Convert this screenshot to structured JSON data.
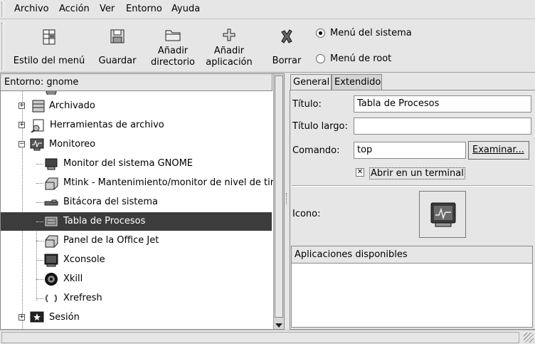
{
  "menubar": {
    "items": [
      "Archivo",
      "Acción",
      "Ver",
      "Entorno",
      "Ayuda"
    ]
  },
  "toolbar": {
    "buttons": [
      {
        "label": "Estilo del menú",
        "icon": "menu-style-icon"
      },
      {
        "label": "Guardar",
        "icon": "floppy-disk-icon"
      },
      {
        "label": "Añadir\ndirectorio",
        "line1": "Añadir",
        "line2": "directorio",
        "icon": "folder-icon"
      },
      {
        "label": "Añadir\naplicación",
        "line1": "Añadir",
        "line2": "aplicación",
        "icon": "add-icon"
      },
      {
        "label": "Borrar",
        "icon": "delete-icon"
      }
    ],
    "radios": [
      {
        "label": "Menú del sistema",
        "selected": true
      },
      {
        "label": "Menú de root",
        "selected": false
      }
    ]
  },
  "tree": {
    "header": "Entorno: gnome",
    "items": [
      {
        "label": "Archivado",
        "level": 0,
        "expander": "+",
        "icon": "archive-icon"
      },
      {
        "label": "Herramientas de archivo",
        "level": 0,
        "expander": "+",
        "icon": "file-tools-icon"
      },
      {
        "label": "Monitoreo",
        "level": 0,
        "expander": "-",
        "icon": "monitor-icon"
      },
      {
        "label": "Monitor del sistema GNOME",
        "level": 1,
        "icon": "system-monitor-icon"
      },
      {
        "label": "Mtink - Mantenimiento/monitor de nivel de tir",
        "level": 1,
        "icon": "printer-icon"
      },
      {
        "label": "Bitácora del sistema",
        "level": 1,
        "icon": "log-icon"
      },
      {
        "label": "Tabla de Procesos",
        "level": 1,
        "icon": "process-table-icon",
        "selected": true
      },
      {
        "label": "Panel de la Office Jet",
        "level": 1,
        "icon": "printer-icon"
      },
      {
        "label": "Xconsole",
        "level": 1,
        "icon": "console-icon"
      },
      {
        "label": "Xkill",
        "level": 1,
        "icon": "xkill-icon"
      },
      {
        "label": "Xrefresh",
        "level": 1,
        "icon": "refresh-icon"
      },
      {
        "label": "Sesión",
        "level": 0,
        "expander": "+",
        "icon": "session-icon"
      }
    ]
  },
  "editor": {
    "tabs": [
      "General",
      "Extendido"
    ],
    "active_tab": "General",
    "titulo_label": "Título:",
    "titulo_value": "Tabla de Procesos",
    "titulo_largo_label": "Título largo:",
    "titulo_largo_value": "",
    "comando_label": "Comando:",
    "comando_value": "top",
    "examinar_label": "Examinar...",
    "terminal_label": "Abrir en un terminal",
    "terminal_checked": true,
    "icono_label": "Icono:",
    "apps_header": "Aplicaciones disponibles"
  }
}
